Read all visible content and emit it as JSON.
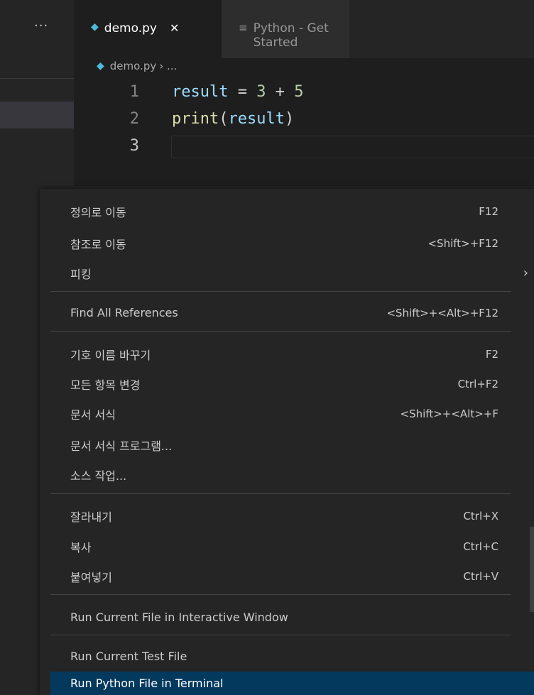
{
  "sidebar": {
    "more_label": "···"
  },
  "tabs": [
    {
      "label": "demo.py",
      "close": "✕",
      "active": true
    },
    {
      "label": "Python - Get Started",
      "active": false
    }
  ],
  "breadcrumb": {
    "file": "demo.py",
    "rest": "› ..."
  },
  "editor": {
    "lines": [
      {
        "number": "1",
        "text": "result = 3 + 5"
      },
      {
        "number": "2",
        "text": "print(result)"
      },
      {
        "number": "3",
        "text": ""
      }
    ]
  },
  "context_menu": {
    "items": [
      {
        "label": "정의로 이동",
        "shortcut": "F12"
      },
      {
        "label": "참조로 이동",
        "shortcut": "<Shift>+F12"
      },
      {
        "label": "피킹",
        "submenu": "›"
      },
      {
        "label": "Find All References",
        "shortcut": "<Shift>+<Alt>+F12"
      },
      {
        "label": "기호 이름 바꾸기",
        "shortcut": "F2"
      },
      {
        "label": "모든 항목 변경",
        "shortcut": "Ctrl+F2"
      },
      {
        "label": "문서 서식",
        "shortcut": "<Shift>+<Alt>+F"
      },
      {
        "label": "문서 서식 프로그램...",
        "shortcut": ""
      },
      {
        "label": "소스 작업...",
        "shortcut": ""
      },
      {
        "label": "잘라내기",
        "shortcut": "Ctrl+X"
      },
      {
        "label": "복사",
        "shortcut": "Ctrl+C"
      },
      {
        "label": "붙여넣기",
        "shortcut": "Ctrl+V"
      },
      {
        "label": "Run Current File in Interactive Window",
        "shortcut": ""
      },
      {
        "label": "Run Current Test File",
        "shortcut": ""
      },
      {
        "label": "Run Python File in Terminal",
        "shortcut": "",
        "highlighted": true
      }
    ]
  },
  "colors": {
    "accent": "#04395e",
    "editor_bg": "#1e1e1e",
    "menu_bg": "#252526",
    "python_icon": "#4fb9d9"
  },
  "icons": [
    "python-file-icon",
    "close-icon",
    "lines-icon",
    "chevron-right-icon"
  ]
}
